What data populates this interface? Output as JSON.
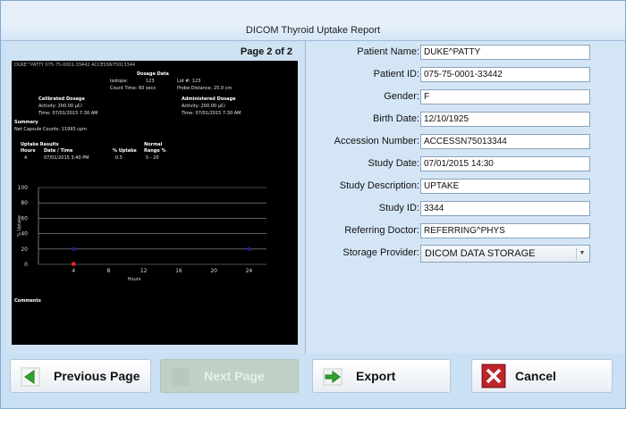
{
  "window": {
    "top_caption": "",
    "title": "DICOM Thyroid Uptake Report"
  },
  "report": {
    "page_indicator": "Page 2 of 2",
    "header_line": "DUKE^PATTY 075-75-0001-33442 ACCESSN75013344",
    "dosage_data_title": "Dosage Data",
    "isotope_label": "Isotope:",
    "isotope_value": "123",
    "lot_label": "Lot #: 123",
    "count_time": "Count Time: 60 secs",
    "probe_distance": "Probe Distance: 25.0 cm",
    "calibrated_title": "Calibrated Dosage",
    "administered_title": "Administered Dosage",
    "calibrated_activity": "Activity: 200.00 µCi",
    "calibrated_time": "Time: 07/01/2015 7:30 AM",
    "administered_activity": "Activity: 200.00 µCi",
    "administered_time": "Time: 07/01/2015 7:30 AM",
    "summary_title": "Summary",
    "summary_text": "Net Capsule Counts: 11993 cpm",
    "uptake_title": "Uptake Results",
    "normal_title": "Normal",
    "col_hours": "Hours",
    "col_datetime": "Date / Time",
    "col_uptake": "% Uptake",
    "col_range": "Range %",
    "row_hours": "4",
    "row_datetime": "07/01/2015 3:40 PM",
    "row_uptake": "0.5",
    "row_range": "5 - 20",
    "comments_title": "Comments"
  },
  "chart_data": {
    "type": "scatter",
    "ylabel": "% Uptake",
    "xlabel": "Hours",
    "x_ticks": [
      "0",
      "4",
      "8",
      "12",
      "16",
      "20",
      "24"
    ],
    "y_ticks": [
      "0",
      "20",
      "40",
      "60",
      "80",
      "100"
    ],
    "xlim": [
      0,
      26
    ],
    "ylim": [
      0,
      100
    ],
    "series": [
      {
        "values": [
          [
            4,
            0.5
          ]
        ],
        "color": "#ff2a2a"
      },
      {
        "values": [
          [
            4,
            20
          ]
        ],
        "color": "#1a1f8c"
      },
      {
        "values": [
          [
            24,
            20
          ]
        ],
        "color": "#1a1f8c"
      }
    ]
  },
  "form": {
    "patient_name": {
      "label": "Patient Name:",
      "value": "DUKE^PATTY"
    },
    "patient_id": {
      "label": "Patient ID:",
      "value": "075-75-0001-33442"
    },
    "gender": {
      "label": "Gender:",
      "value": "F"
    },
    "birth_date": {
      "label": "Birth Date:",
      "value": "12/10/1925"
    },
    "accession_number": {
      "label": "Accession Number:",
      "value": "ACCESSN75013344"
    },
    "study_date": {
      "label": "Study Date:",
      "value": "07/01/2015 14:30"
    },
    "study_description": {
      "label": "Study Description:",
      "value": "UPTAKE"
    },
    "study_id": {
      "label": "Study ID:",
      "value": "3344"
    },
    "referring_doctor": {
      "label": "Referring Doctor:",
      "value": "REFERRING^PHYS"
    },
    "storage_provider": {
      "label": "Storage Provider:",
      "value": "DICOM DATA STORAGE"
    }
  },
  "buttons": {
    "previous": "Previous Page",
    "next": "Next Page",
    "export": "Export",
    "cancel": "Cancel"
  },
  "colors": {
    "window_bg": "#c9e0f5",
    "preview_bg": "#000000",
    "cancel_icon": "#c0232b",
    "arrow_icon": "#2fa52f"
  },
  "icons": {
    "previous": "arrow-left-icon",
    "next": "arrow-right-icon",
    "export": "export-arrow-icon",
    "cancel": "close-x-icon"
  }
}
